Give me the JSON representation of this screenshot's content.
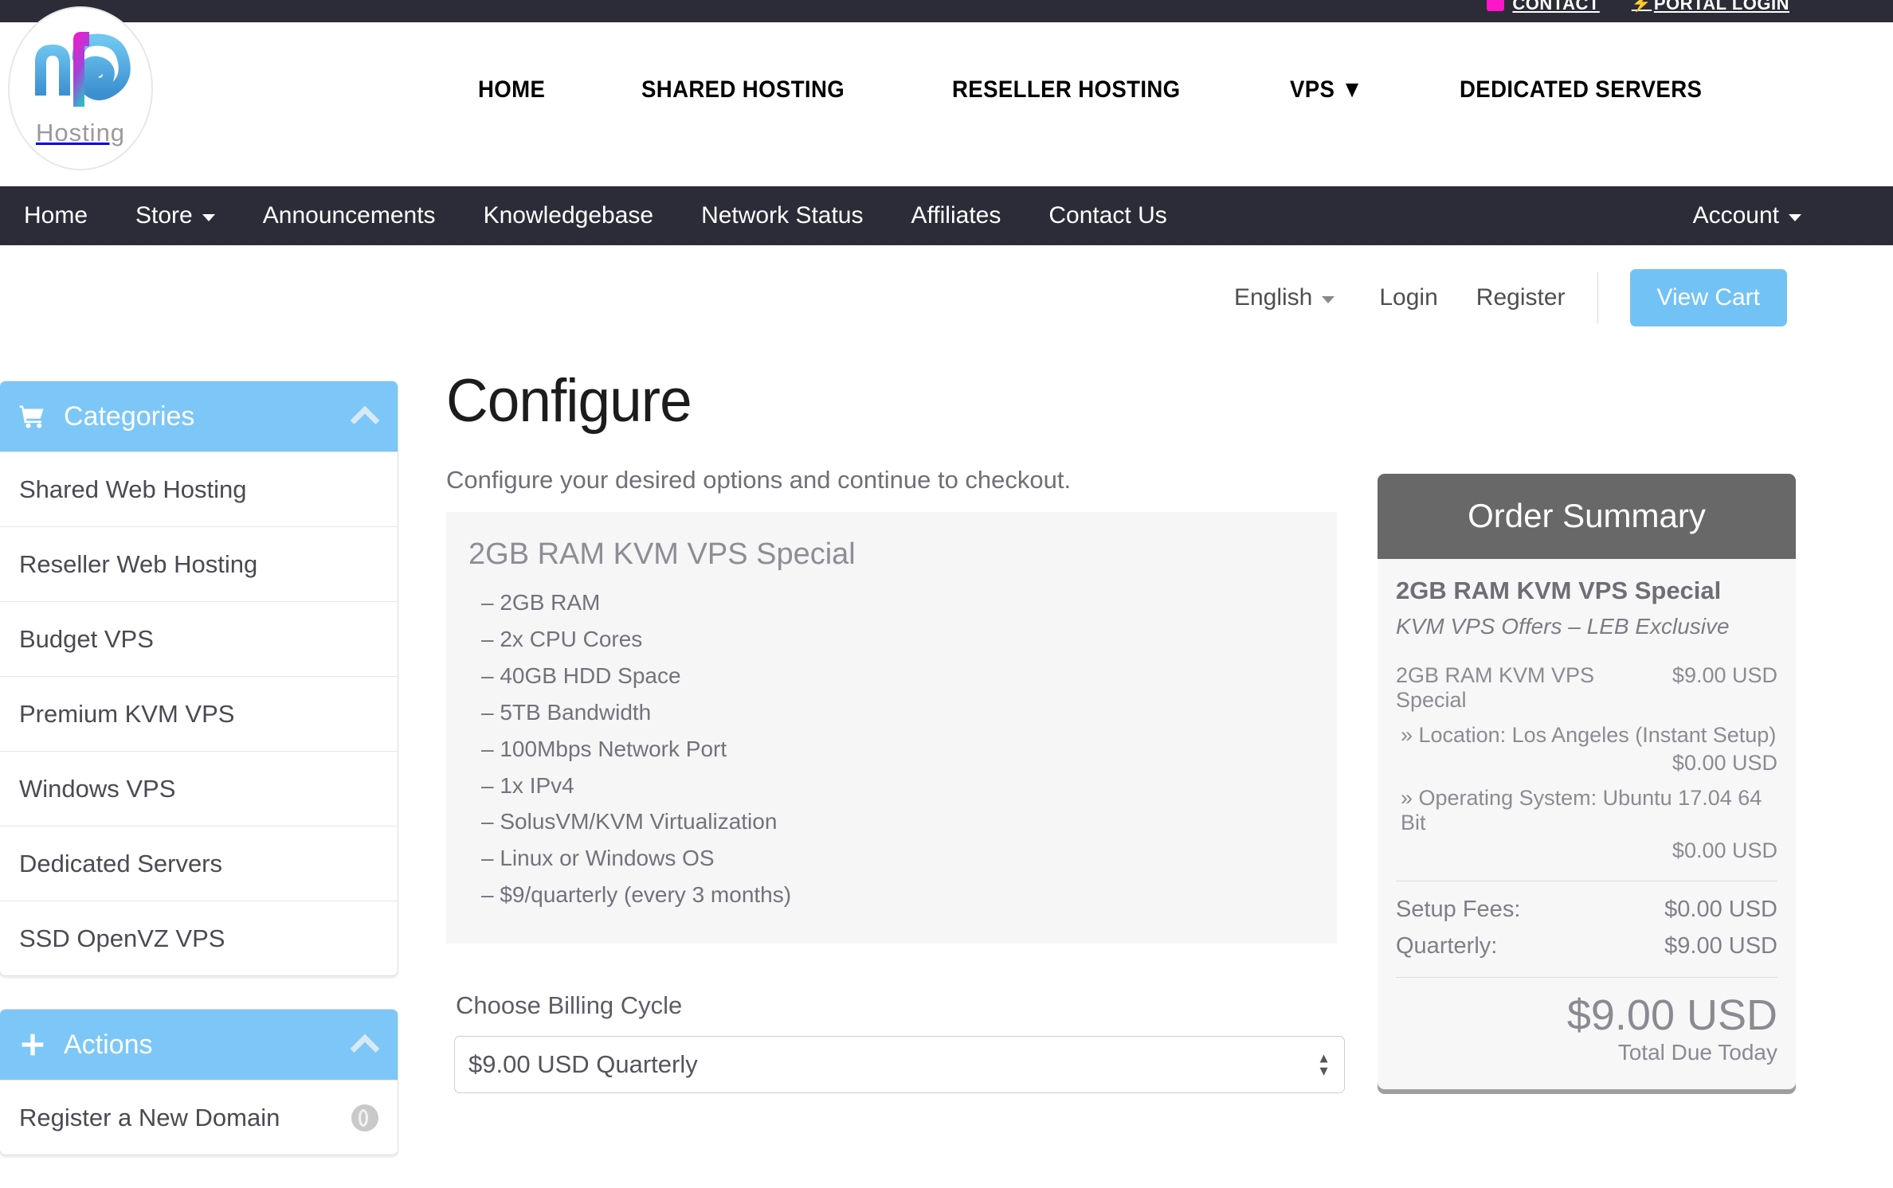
{
  "topbar": {
    "links": [
      {
        "label": "CONTACT",
        "icon": "envelope-icon"
      },
      {
        "label": "PORTAL LOGIN",
        "icon": "bolt-icon"
      }
    ]
  },
  "brand": {
    "logo_text": "nf6",
    "logo_sub": "Hosting"
  },
  "mainnav": {
    "items": [
      {
        "label": "HOME"
      },
      {
        "label": "SHARED HOSTING"
      },
      {
        "label": "RESELLER HOSTING"
      },
      {
        "label": "VPS ▼"
      },
      {
        "label": "DEDICATED SERVERS"
      }
    ]
  },
  "subnav": {
    "items": [
      {
        "label": "Home",
        "caret": false
      },
      {
        "label": "Store",
        "caret": true
      },
      {
        "label": "Announcements",
        "caret": false
      },
      {
        "label": "Knowledgebase",
        "caret": false
      },
      {
        "label": "Network Status",
        "caret": false
      },
      {
        "label": "Affiliates",
        "caret": false
      },
      {
        "label": "Contact Us",
        "caret": false
      }
    ],
    "account_label": "Account"
  },
  "userbar": {
    "language": "English",
    "login": "Login",
    "register": "Register",
    "view_cart": "View Cart"
  },
  "sidebar": {
    "categories": {
      "title": "Categories",
      "icon": "cart-icon",
      "items": [
        {
          "label": "Shared Web Hosting"
        },
        {
          "label": "Reseller Web Hosting"
        },
        {
          "label": "Budget VPS"
        },
        {
          "label": "Premium KVM VPS"
        },
        {
          "label": "Windows VPS"
        },
        {
          "label": "Dedicated Servers"
        },
        {
          "label": "SSD OpenVZ VPS"
        }
      ]
    },
    "actions": {
      "title": "Actions",
      "icon": "plus-icon",
      "items": [
        {
          "label": "Register a New Domain",
          "icon": "globe-icon"
        }
      ]
    }
  },
  "main": {
    "title": "Configure",
    "subtitle": "Configure your desired options and continue to checkout.",
    "product": {
      "name": "2GB RAM KVM VPS Special",
      "features": [
        "– 2GB RAM",
        "– 2x CPU Cores",
        "– 40GB HDD Space",
        "– 5TB Bandwidth",
        "– 100Mbps Network Port",
        "– 1x IPv4",
        "– SolusVM/KVM Virtualization",
        "– Linux or Windows OS",
        "– $9/quarterly (every 3 months)"
      ]
    },
    "billing": {
      "label": "Choose Billing Cycle",
      "selected": "$9.00 USD Quarterly",
      "options": [
        "$9.00 USD Quarterly"
      ]
    }
  },
  "summary": {
    "heading": "Order Summary",
    "product_name": "2GB RAM KVM VPS Special",
    "product_group": "KVM VPS Offers – LEB Exclusive",
    "base_line": {
      "label": "2GB RAM KVM VPS Special",
      "price": "$9.00 USD"
    },
    "config_options": [
      {
        "label": "» Location: Los Angeles (Instant Setup)",
        "price": "$0.00 USD"
      },
      {
        "label": "» Operating System: Ubuntu 17.04 64 Bit",
        "price": "$0.00 USD"
      }
    ],
    "fees": [
      {
        "label": "Setup Fees:",
        "value": "$0.00 USD"
      },
      {
        "label": "Quarterly:",
        "value": "$9.00 USD"
      }
    ],
    "total": "$9.00 USD",
    "total_label": "Total Due Today"
  },
  "colors": {
    "accent_blue": "#7cc7f7",
    "dark_nav": "#2c2c38",
    "summary_head": "#686868",
    "magenta": "#ff16c8"
  }
}
